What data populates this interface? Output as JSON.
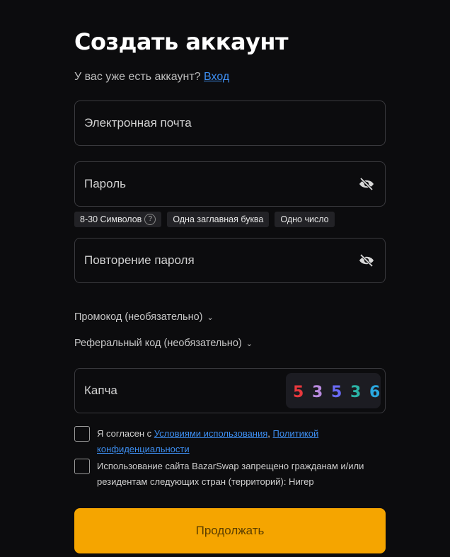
{
  "header": {
    "title": "Создать аккаунт",
    "have_account_text": "У вас уже есть аккаунт?",
    "login_link": "Вход"
  },
  "form": {
    "email_placeholder": "Электронная почта",
    "password_placeholder": "Пароль",
    "password_requirements": [
      "8-30 Символов",
      "Одна заглавная буква",
      "Одно число"
    ],
    "repeat_password_placeholder": "Повторение пароля",
    "promo_label": "Промокод (необязательно)",
    "referral_label": "Реферальный код (необязательно)",
    "captcha_placeholder": "Капча",
    "captcha_digits": [
      "5",
      "3",
      "5",
      "3",
      "6"
    ],
    "captcha_colors": [
      "#e8383d",
      "#b98adf",
      "#6a6af5",
      "#2bb3a6",
      "#2aa8e0"
    ]
  },
  "agreements": {
    "terms_prefix": "Я согласен с",
    "terms_link": "Условиями использования",
    "terms_sep": ",",
    "privacy_link": "Политикой конфиденциальности",
    "restriction_text": "Использование сайта BazarSwap запрещено гражданам и/или резидентам следующих стран (территорий): Нигер"
  },
  "submit_label": "Продолжать",
  "colors": {
    "accent": "#f5a500",
    "link": "#3d8ef0",
    "background": "#0c0c0e"
  },
  "icons": {
    "eye": "eye-off-icon",
    "chevron": "chevron-down-icon",
    "help": "question-icon"
  }
}
